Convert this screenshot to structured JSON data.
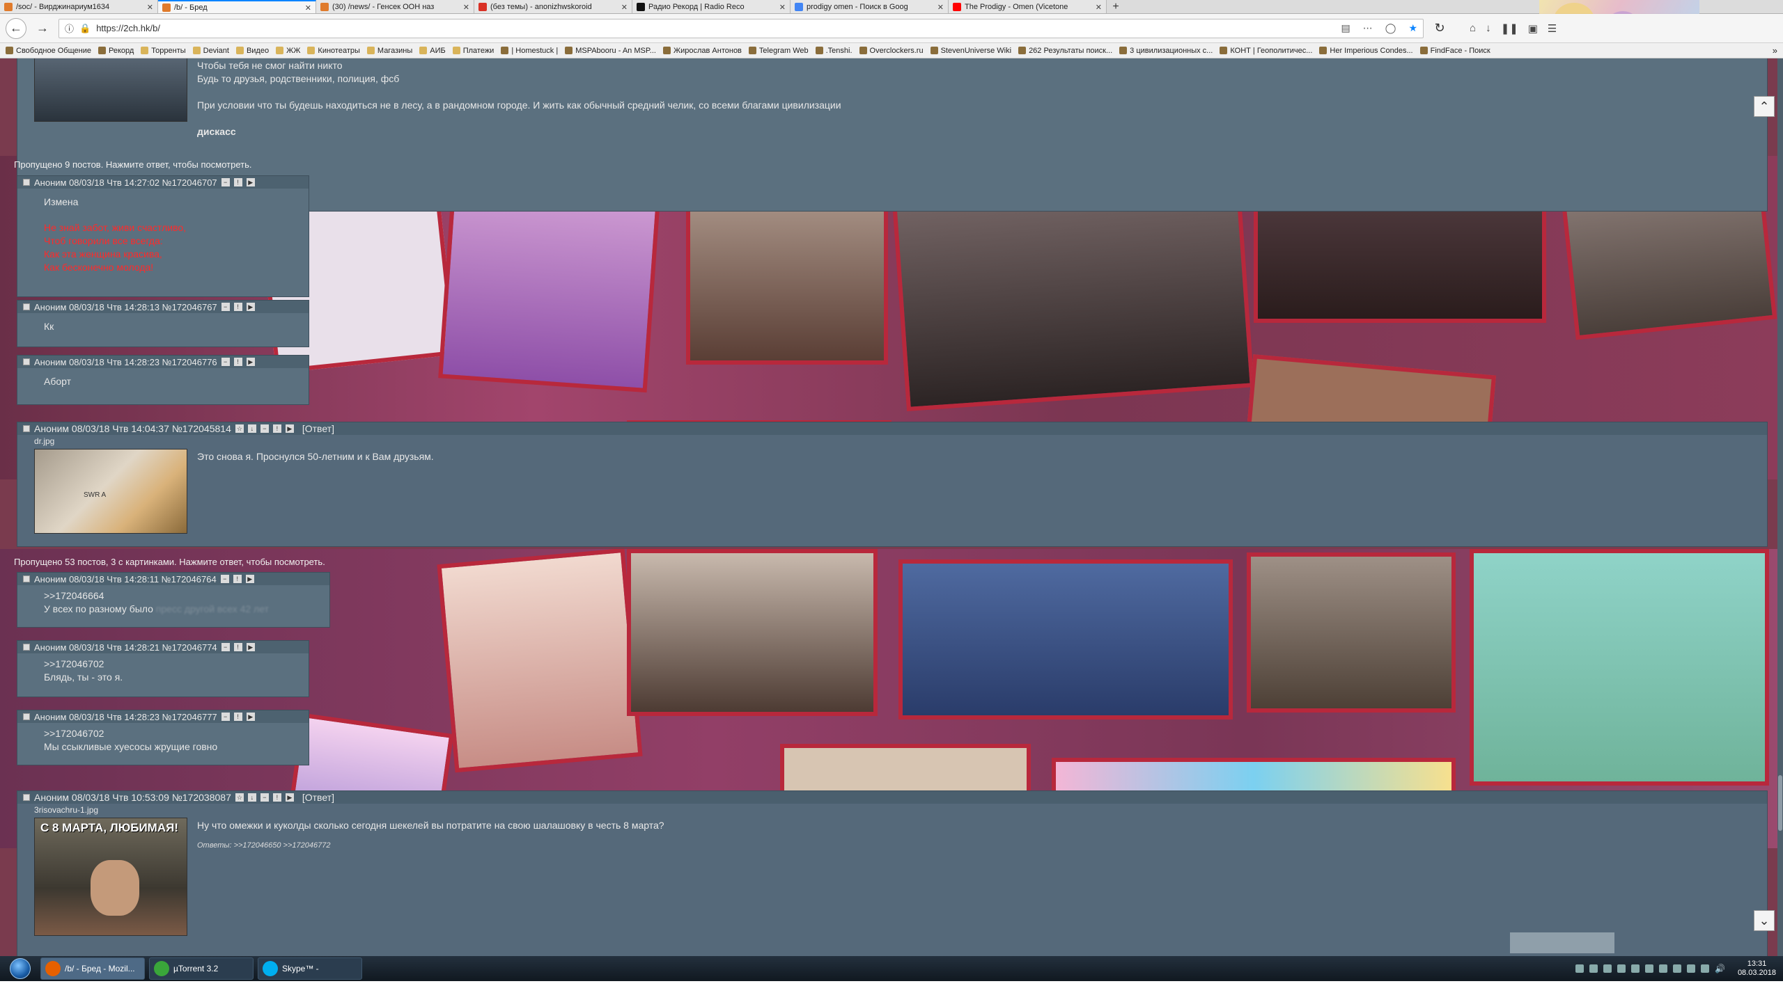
{
  "browser": {
    "tabs": [
      {
        "title": "/soc/ - Вирджинариум1634",
        "active": false,
        "icon_color": "#e07b2c"
      },
      {
        "title": "/b/ - Бред",
        "active": true,
        "icon_color": "#e07b2c"
      },
      {
        "title": "(30) /news/ - Генсек ООН наз",
        "active": false,
        "icon_color": "#e07b2c"
      },
      {
        "title": "(без темы) - anonizhwskoroid",
        "active": false,
        "icon_color": "#d93025"
      },
      {
        "title": "Радио Рекорд | Radio Reco",
        "active": false,
        "icon_color": "#111111"
      },
      {
        "title": "prodigy omen - Поиск в Goog",
        "active": false,
        "icon_color": "#4285f4"
      },
      {
        "title": "The Prodigy - Omen (Vicetone",
        "active": false,
        "icon_color": "#ff0000"
      }
    ],
    "url": "https://2ch.hk/b/",
    "bookmarks": [
      {
        "label": "Свободное Общение",
        "folder": false
      },
      {
        "label": "Рекорд",
        "folder": false
      },
      {
        "label": "Торренты",
        "folder": true
      },
      {
        "label": "Deviant",
        "folder": true
      },
      {
        "label": "Видео",
        "folder": true
      },
      {
        "label": "ЖЖ",
        "folder": true
      },
      {
        "label": "Кинотеатры",
        "folder": true
      },
      {
        "label": "Магазины",
        "folder": true
      },
      {
        "label": "АИБ",
        "folder": true
      },
      {
        "label": "Платежи",
        "folder": true
      },
      {
        "label": "| Homestuck |",
        "folder": false
      },
      {
        "label": "MSPAbooru - An MSP...",
        "folder": false
      },
      {
        "label": "Жирослав Антонов",
        "folder": false
      },
      {
        "label": "Telegram Web",
        "folder": false
      },
      {
        "label": ".Tenshi.",
        "folder": false
      },
      {
        "label": "Overclockers.ru",
        "folder": false
      },
      {
        "label": "StevenUniverse Wiki",
        "folder": false
      },
      {
        "label": "262 Результаты поиск...",
        "folder": false
      },
      {
        "label": "3 цивилизационных с...",
        "folder": false
      },
      {
        "label": "КОНТ | Геополитичес...",
        "folder": false
      },
      {
        "label": "Her Imperious Condes...",
        "folder": false
      },
      {
        "label": "FindFace - Поиск",
        "folder": false
      }
    ]
  },
  "board": {
    "op1": {
      "lines": [
        "Чтобы тебя не смог найти никто",
        "Будь то друзья, родственники, полиция, фсб",
        "При условии что ты будешь находиться не в лесу, а в рандомном городе. И жить как обычный средний челик, со всеми благами цивилизации",
        "дискасс"
      ]
    },
    "omitted1": "Пропущено 9 постов. Нажмите ответ, чтобы посмотреть.",
    "replies1": [
      {
        "header": "Аноним 08/03/18 Чтв 14:27:02 №172046707",
        "lines": [
          "Измена"
        ],
        "red_lines": [
          "Не знай забот, живи счастливо,",
          "Чтоб говорили все всегда:",
          "Как эта женщина красива,",
          "Как бесконечно молода!"
        ]
      },
      {
        "header": "Аноним 08/03/18 Чтв 14:28:13 №172046767",
        "lines": [
          "Кк"
        ]
      },
      {
        "header": "Аноним 08/03/18 Чтв 14:28:23 №172046776",
        "lines": [
          "Аборт"
        ]
      }
    ],
    "op2": {
      "header": "Аноним 08/03/18 Чтв 14:04:37 №172045814",
      "reply_label": "[Ответ]",
      "filename": "dr.jpg",
      "thumb_text": "SWR A",
      "text": "Это снова я. Проснулся 50-летним и к Вам друзьям."
    },
    "omitted2": "Пропущено 53 постов, 3 с картинками. Нажмите ответ, чтобы посмотреть.",
    "replies2": [
      {
        "header": "Аноним 08/03/18 Чтв 14:28:11 №172046764",
        "lines": [
          ">>172046664",
          "У всех по разному было"
        ],
        "ghost": "пресс другой всех 42 лет"
      },
      {
        "header": "Аноним 08/03/18 Чтв 14:28:21 №172046774",
        "lines": [
          ">>172046702",
          "Блядь, ты - это я."
        ]
      },
      {
        "header": "Аноним 08/03/18 Чтв 14:28:23 №172046777",
        "lines": [
          ">>172046702",
          "Мы ссыкливые хуесосы жрущие говно"
        ]
      }
    ],
    "op3": {
      "header": "Аноним 08/03/18 Чтв 10:53:09 №172038087",
      "reply_label": "[Ответ]",
      "filename": "3risovachru-1.jpg",
      "thumb_caption": "С 8 МАРТА, ЛЮБИМАЯ!",
      "text": "Ну что омежки и куколды сколько сегодня шекелей вы потратите на свою шалашовку в честь 8 марта?",
      "replies_label": "Ответы: >>172046650 >>172046772"
    }
  },
  "taskbar": {
    "tasks": [
      {
        "label": "/b/ - Бред - Mozil...",
        "active": true,
        "icon_color": "#e66000"
      },
      {
        "label": "µTorrent 3.2",
        "active": false,
        "icon_color": "#3aa63a"
      },
      {
        "label": "Skype™ -",
        "active": false,
        "icon_color": "#00aff0"
      }
    ],
    "time": "13:31",
    "date": "08.03.2018"
  }
}
